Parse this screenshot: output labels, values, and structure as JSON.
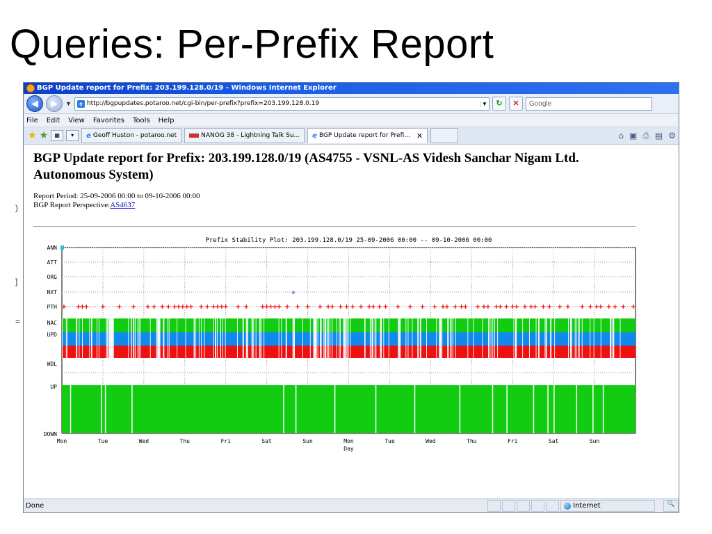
{
  "slide": {
    "title": "Queries:  Per-Prefix Report"
  },
  "browser": {
    "window_title": "BGP Update report for Prefix: 203.199.128.0/19 - Windows Internet Explorer",
    "address": "http://bgpupdates.potaroo.net/cgi-bin/per-prefix?prefix=203.199.128.0.19",
    "search_placeholder": "Google",
    "menu": [
      "File",
      "Edit",
      "View",
      "Favorites",
      "Tools",
      "Help"
    ],
    "tabs": [
      {
        "label": "Geoff Huston - potaroo.net",
        "active": false
      },
      {
        "label": "NANOG 38 - Lightning Talk Su...",
        "active": false
      },
      {
        "label": "BGP Update report for Prefi...",
        "active": true
      }
    ],
    "status": {
      "text": "Done",
      "zone": "Internet"
    }
  },
  "page": {
    "heading": "BGP Update report for Prefix: 203.199.128.0/19 (AS4755 - VSNL-AS Videsh Sanchar Nigam Ltd. Autonomous System)",
    "report_period_label": "Report Period:",
    "report_period": "25-09-2006 00:00 to 09-10-2006 00:00",
    "perspective_label": "BGP Report Perspective:",
    "perspective_link": "AS4637"
  },
  "chart_data": {
    "type": "scatter",
    "title": "Prefix Stability Plot: 203.199.128.0/19  25-09-2006 00:00 -- 09-10-2006 00:00",
    "xlabel": "Day",
    "ylabel": "",
    "categories_y": [
      "ANN",
      "ATT",
      "ORG",
      "NXT",
      "PTH",
      "NAC",
      "UPD",
      "WDL",
      "UP",
      "DOWN"
    ],
    "x_ticks": [
      "Mon",
      "Tue",
      "Wed",
      "Thu",
      "Fri",
      "Sat",
      "Sun",
      "Mon",
      "Tue",
      "Wed",
      "Thu",
      "Fri",
      "Sat",
      "Sun"
    ],
    "xlim_days": [
      0,
      14
    ],
    "series": [
      {
        "name": "ANN",
        "color": "#33bbdd",
        "x": [
          0.0
        ]
      },
      {
        "name": "NXT",
        "color": "#3377ee",
        "x": [
          5.65
        ]
      },
      {
        "name": "PTH",
        "color": "#ee1111",
        "x": [
          0.05,
          0.4,
          0.5,
          0.6,
          1.0,
          1.4,
          1.75,
          2.1,
          2.25,
          2.45,
          2.6,
          2.75,
          2.85,
          2.95,
          3.05,
          3.15,
          3.4,
          3.55,
          3.7,
          3.8,
          3.9,
          4.0,
          4.3,
          4.5,
          4.9,
          5.0,
          5.1,
          5.2,
          5.3,
          5.5,
          5.75,
          6.0,
          6.3,
          6.5,
          6.6,
          6.8,
          6.95,
          7.1,
          7.3,
          7.5,
          7.6,
          7.75,
          7.9,
          8.2,
          8.5,
          8.8,
          9.1,
          9.3,
          9.4,
          9.6,
          9.75,
          9.85,
          10.15,
          10.3,
          10.4,
          10.6,
          10.7,
          10.85,
          11.0,
          11.1,
          11.3,
          11.45,
          11.55,
          11.75,
          11.9,
          12.15,
          12.35,
          12.7,
          12.9,
          13.05,
          13.15,
          13.35,
          13.5,
          13.7,
          13.95
        ]
      },
      {
        "name": "NAC",
        "color": "#11cc11"
      },
      {
        "name": "UPD",
        "color": "#1188ee"
      },
      {
        "name": "WDL",
        "color": "#ee1111"
      },
      {
        "name": "UP",
        "color": "#11cc11",
        "down_gaps_days": [
          0.2,
          0.95,
          1.05,
          1.7,
          5.4,
          5.7,
          6.65,
          7.65,
          8.6,
          9.7,
          10.5,
          10.85,
          11.5,
          11.85,
          12.0,
          12.55,
          12.95,
          13.2
        ]
      }
    ]
  }
}
